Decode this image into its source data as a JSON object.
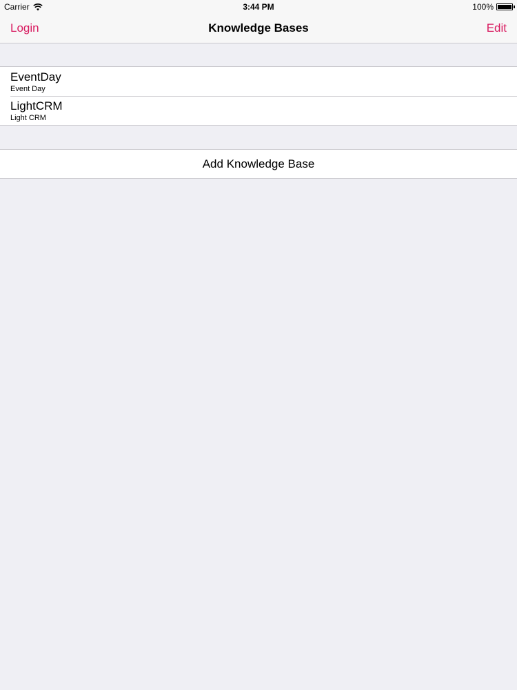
{
  "status_bar": {
    "carrier": "Carrier",
    "wifi_icon": "wifi-icon",
    "time": "3:44 PM",
    "battery_percent": "100%",
    "battery_icon": "battery-icon",
    "battery_level": 1.0
  },
  "nav_bar": {
    "left_button": "Login",
    "title": "Knowledge Bases",
    "right_button": "Edit",
    "tint_color": "#d81b60"
  },
  "knowledge_bases": [
    {
      "title": "EventDay",
      "subtitle": "Event Day"
    },
    {
      "title": "LightCRM",
      "subtitle": "Light CRM"
    }
  ],
  "actions": {
    "add_label": "Add Knowledge Base"
  }
}
